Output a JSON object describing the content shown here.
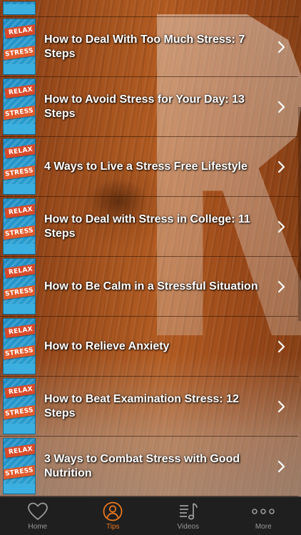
{
  "list": {
    "thumb_text_top": "RELAX",
    "thumb_text_mid": "STRESS",
    "items": [
      {
        "title": "How to Deal With Too Much Stress: 7 Steps"
      },
      {
        "title": "How to Avoid Stress for Your Day: 13 Steps"
      },
      {
        "title": "4 Ways to Live a Stress Free Lifestyle"
      },
      {
        "title": "How to Deal with Stress in College: 11 Steps"
      },
      {
        "title": "How to Be Calm in a Stressful Situation"
      },
      {
        "title": "How to Relieve Anxiety"
      },
      {
        "title": "How to Beat Examination Stress: 12 Steps"
      },
      {
        "title": "3 Ways to Combat Stress with Good Nutrition"
      }
    ]
  },
  "tabbar": {
    "tabs": [
      {
        "label": "Home",
        "icon": "heart-icon",
        "active": false
      },
      {
        "label": "Tips",
        "icon": "user-icon",
        "active": true
      },
      {
        "label": "Videos",
        "icon": "music-list-icon",
        "active": false
      },
      {
        "label": "More",
        "icon": "more-dots-icon",
        "active": false
      }
    ]
  },
  "colors": {
    "accent": "#e8761f",
    "tab_inactive": "#9a9a9a",
    "tabbar_bg": "#1f1f1f"
  }
}
